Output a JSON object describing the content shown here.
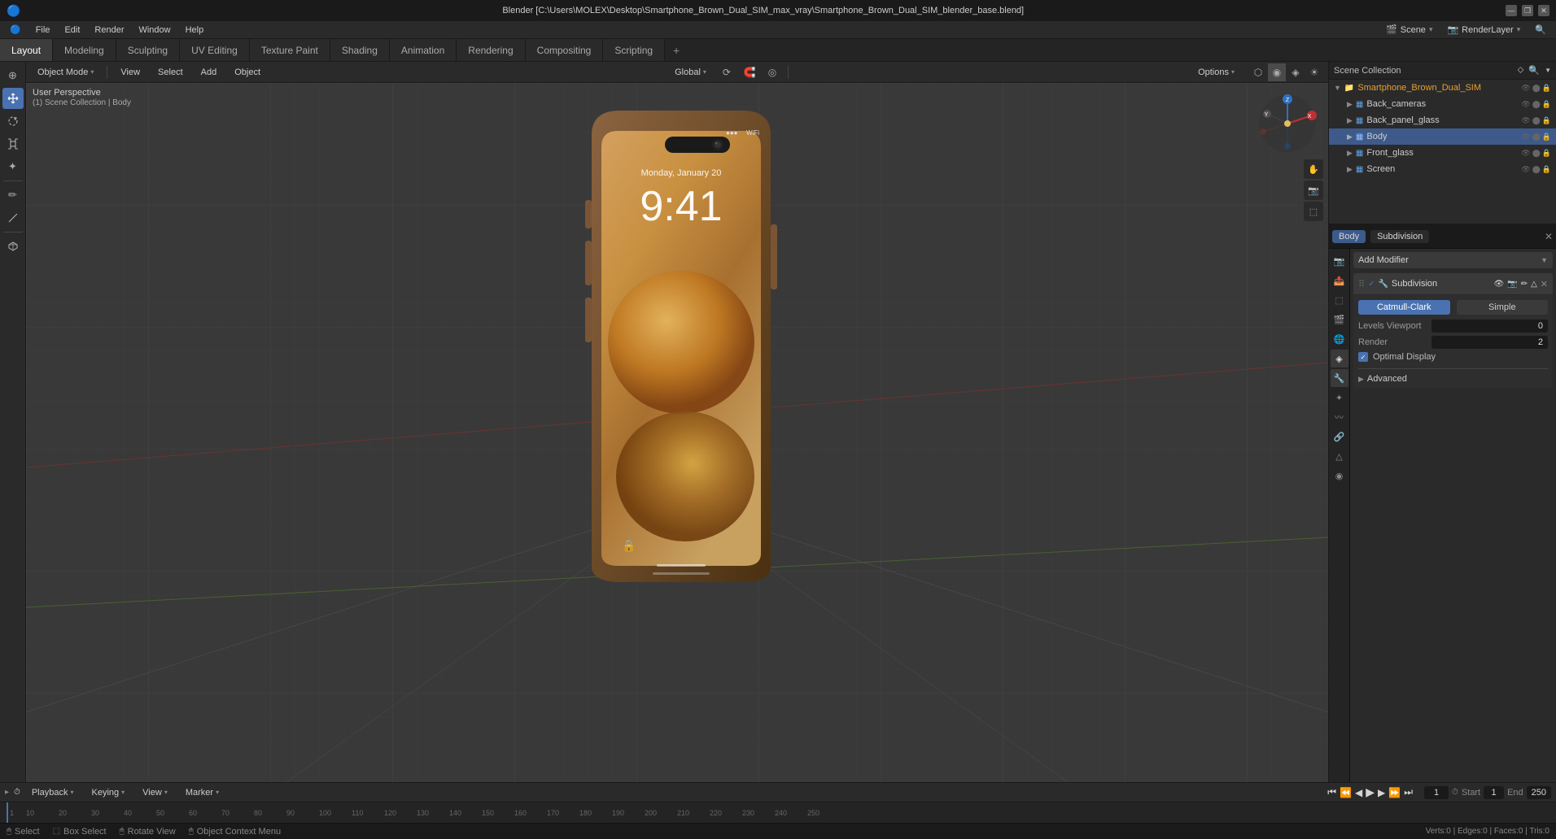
{
  "window": {
    "title": "Blender [C:\\Users\\MOLEX\\Desktop\\Smartphone_Brown_Dual_SIM_max_vray\\Smartphone_Brown_Dual_SIM_blender_base.blend]",
    "controls": [
      "—",
      "❐",
      "✕"
    ]
  },
  "menu_bar": {
    "items": [
      "Blender",
      "File",
      "Edit",
      "Render",
      "Window",
      "Help"
    ]
  },
  "workspace_tabs": {
    "tabs": [
      "Layout",
      "Modeling",
      "Sculpting",
      "UV Editing",
      "Texture Paint",
      "Shading",
      "Animation",
      "Rendering",
      "Compositing",
      "Scripting"
    ],
    "active": "Layout",
    "add_label": "+"
  },
  "viewport_header": {
    "mode_label": "Object Mode",
    "mode_arrow": "▾",
    "view_label": "View",
    "select_label": "Select",
    "add_label": "Add",
    "object_label": "Object",
    "global_label": "Global",
    "global_arrow": "▾",
    "options_label": "Options",
    "options_arrow": "▾"
  },
  "viewport": {
    "perspective_label": "User Perspective",
    "collection_label": "(1) Scene Collection | Body",
    "grid_color": "#3a3a3a",
    "axis_x_color": "#b03030",
    "axis_y_color": "#6a8a30",
    "axis_z_color": "#2060a0"
  },
  "phone": {
    "time_label": "9:41",
    "date_label": "Monday, January 20",
    "frame_color": "#6b4a28",
    "screen_bg": "#c89040"
  },
  "outliner": {
    "title": "Scene Collection",
    "items": [
      {
        "name": "Smartphone_Brown_Dual_SIM",
        "indent": 0,
        "icon": "▶",
        "type": "collection"
      },
      {
        "name": "Back_cameras",
        "indent": 1,
        "icon": "▶",
        "type": "object"
      },
      {
        "name": "Back_panel_glass",
        "indent": 1,
        "icon": "▶",
        "type": "object"
      },
      {
        "name": "Body",
        "indent": 1,
        "icon": "▶",
        "type": "object",
        "selected": true
      },
      {
        "name": "Front_glass",
        "indent": 1,
        "icon": "▶",
        "type": "object"
      },
      {
        "name": "Screen",
        "indent": 1,
        "icon": "▶",
        "type": "object"
      }
    ]
  },
  "properties_panel": {
    "top_objects": [
      {
        "label": "Body",
        "active": true
      },
      {
        "label": "Subdivision",
        "active": false
      }
    ],
    "add_modifier_label": "Add Modifier",
    "modifier": {
      "name": "Subdivision",
      "type_label": "Subdivision",
      "catmull_label": "Catmull-Clark",
      "simple_label": "Simple",
      "levels_viewport_label": "Levels Viewport",
      "levels_viewport_value": "0",
      "render_label": "Render",
      "render_value": "2",
      "optimal_display_label": "Optimal Display",
      "optimal_display_checked": true,
      "advanced_label": "Advanced"
    }
  },
  "timeline": {
    "playback_label": "Playback",
    "keying_label": "Keying",
    "view_label": "View",
    "marker_label": "Marker",
    "current_frame": "1",
    "start_label": "Start",
    "start_value": "1",
    "end_label": "End",
    "end_value": "250",
    "ruler_marks": [
      "10",
      "20",
      "30",
      "40",
      "50",
      "60",
      "70",
      "80",
      "90",
      "100",
      "110",
      "120",
      "130",
      "140",
      "150",
      "160",
      "170",
      "180",
      "190",
      "200",
      "210",
      "220",
      "230",
      "240",
      "250"
    ]
  },
  "status_bar": {
    "items": [
      "Select",
      "Box Select",
      "Rotate View",
      "Object Context Menu"
    ]
  },
  "icons": {
    "cursor": "⊕",
    "move": "↔",
    "rotate": "↻",
    "scale": "⤢",
    "transform": "✦",
    "annotate": "✏",
    "measure": "📏",
    "add_cube": "⬛",
    "search": "🔍",
    "scene": "🎬",
    "render_layer": "📷"
  }
}
